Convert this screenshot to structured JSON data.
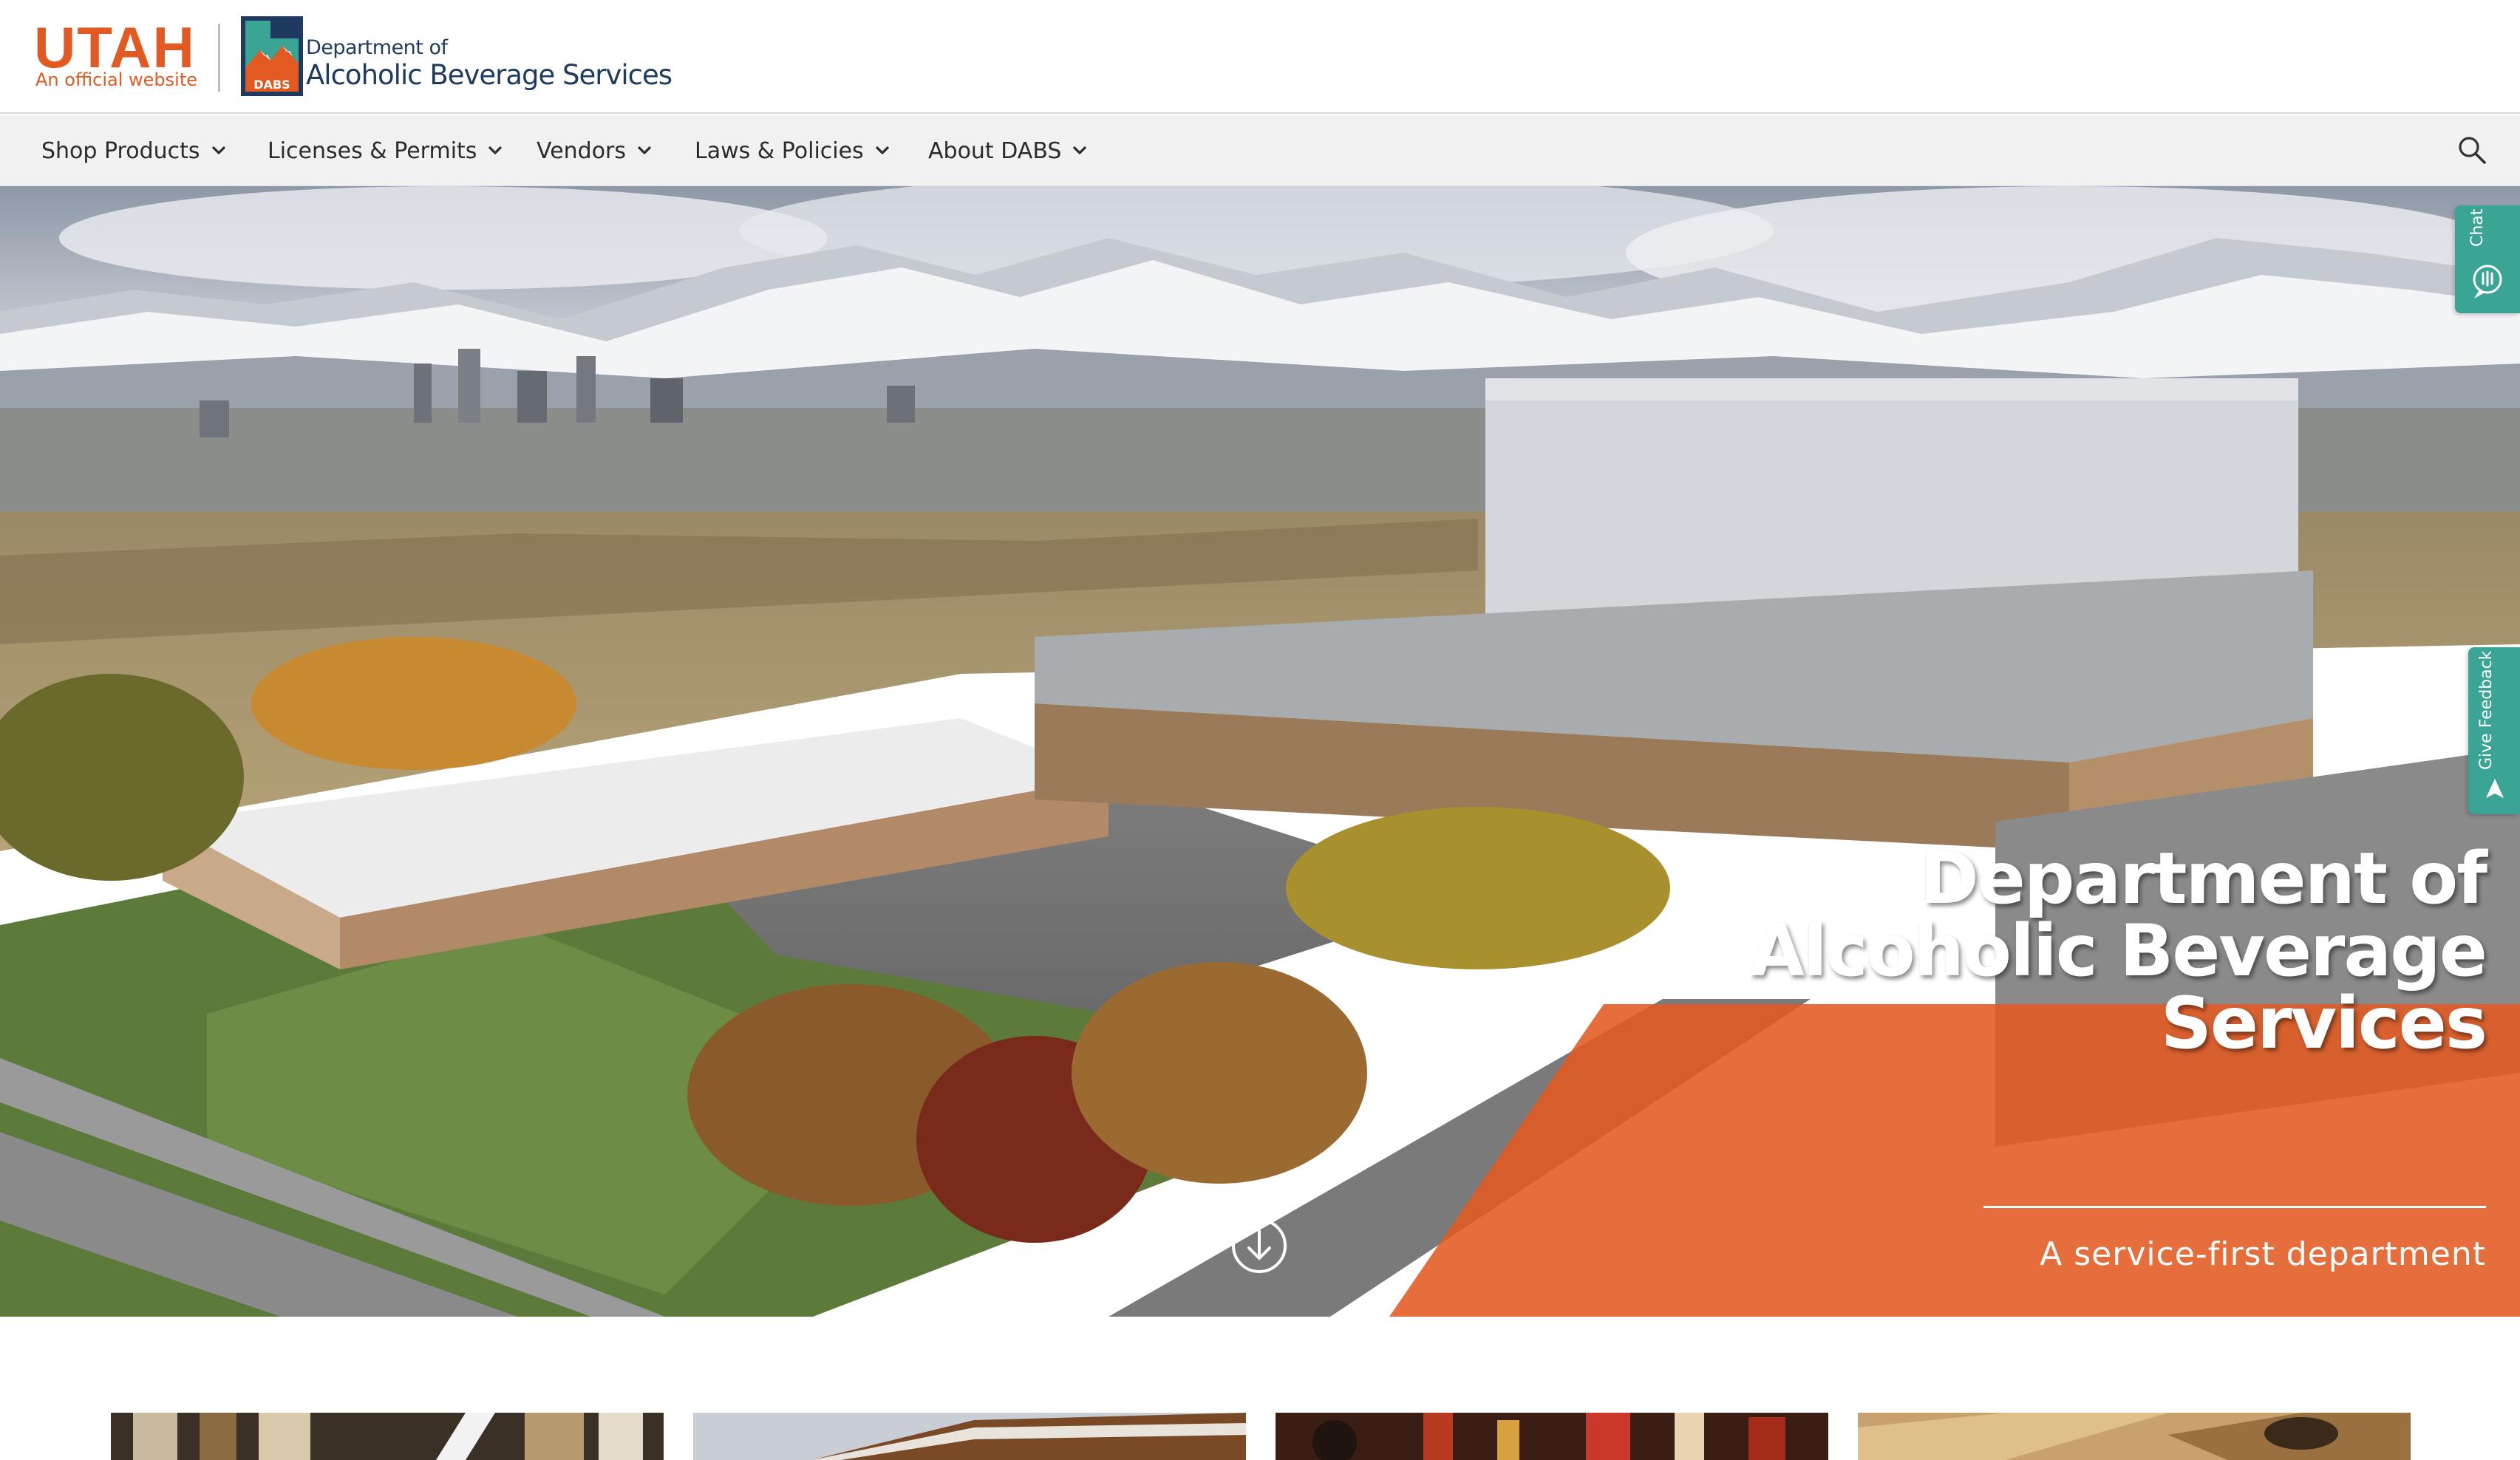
{
  "header": {
    "utah_wordmark": "UTAH",
    "utah_subtitle": "An official website",
    "dabs_badge": "DABS",
    "dabs_dept": "Department of",
    "dabs_name": "Alcoholic Beverage Services"
  },
  "nav": {
    "items": [
      {
        "label": "Shop Products",
        "icon": "chevron-down-icon"
      },
      {
        "label": "Licenses & Permits",
        "icon": "chevron-down-icon"
      },
      {
        "label": "Vendors",
        "icon": "chevron-down-icon"
      },
      {
        "label": "Laws & Policies",
        "icon": "chevron-down-icon"
      },
      {
        "label": "About DABS",
        "icon": "chevron-down-icon"
      }
    ],
    "search_icon": "search-icon"
  },
  "hero": {
    "title": "Department of Alcoholic Beverage Services",
    "tagline": "A service-first department",
    "scroll_icon": "arrow-down-circle-icon"
  },
  "side_tabs": {
    "chat_label": "Chat",
    "feedback_label": "Give Feedback"
  },
  "colors": {
    "brand_orange": "#e25a21",
    "navy": "#1f3a5f",
    "teal_tab": "#3aa495",
    "nav_bg": "#f1f1f1"
  }
}
